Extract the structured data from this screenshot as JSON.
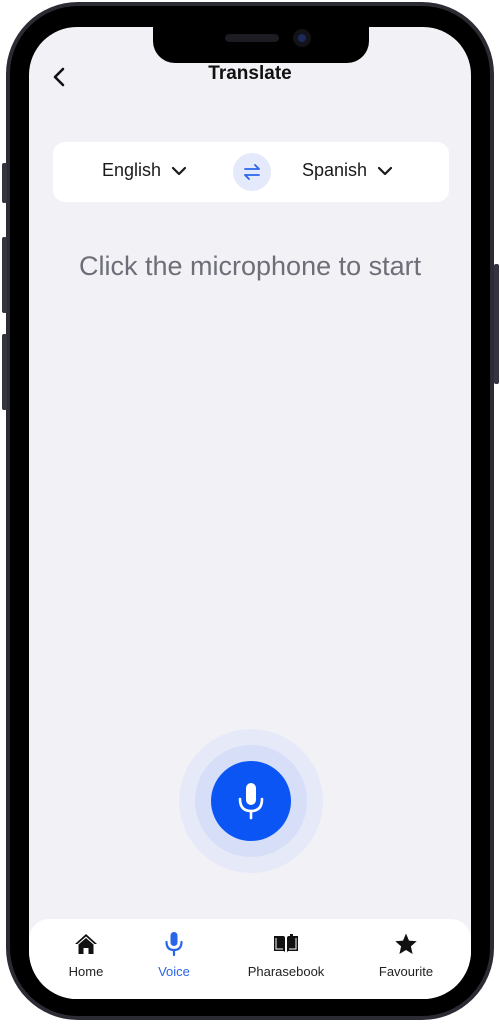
{
  "header": {
    "title": "Translate",
    "back_icon": "chevron-left-icon"
  },
  "languages": {
    "source": "English",
    "target": "Spanish",
    "dropdown_icon": "chevron-down-icon",
    "swap_icon": "swap-arrows-icon"
  },
  "main": {
    "prompt": "Click the microphone to start",
    "mic_icon": "microphone-icon"
  },
  "tabbar": {
    "active": "Voice",
    "items": [
      {
        "label": "Home",
        "icon": "home-icon"
      },
      {
        "label": "Voice",
        "icon": "microphone-icon"
      },
      {
        "label": "Pharasebook",
        "icon": "book-icon"
      },
      {
        "label": "Favourite",
        "icon": "star-icon"
      }
    ]
  },
  "colors": {
    "accent": "#0B55F5",
    "active_tab": "#2A66E8",
    "background": "#F2F2F6",
    "prompt_text": "#6E6E78"
  }
}
